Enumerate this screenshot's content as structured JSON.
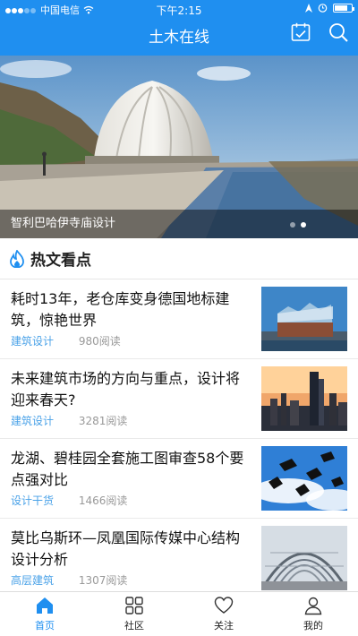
{
  "status_bar": {
    "carrier": "中国电信",
    "time": "下午2:15"
  },
  "nav": {
    "title": "土木在线",
    "icons": [
      "calendar-icon",
      "search-icon"
    ]
  },
  "banner": {
    "caption": "智利巴哈伊寺庙设计",
    "dot_count": 2,
    "active_dot": 2
  },
  "section": {
    "title": "热文看点",
    "icon": "flame-icon"
  },
  "articles": [
    {
      "title": "耗时13年，老仓库变身德国地标建筑，惊艳世界",
      "category": "建筑设计",
      "reads": "980阅读"
    },
    {
      "title": "未来建筑市场的方向与重点，设计将迎来春天?",
      "category": "建筑设计",
      "reads": "3281阅读"
    },
    {
      "title": "龙湖、碧桂园全套施工图审查58个要点强对比",
      "category": "设计干货",
      "reads": "1466阅读"
    },
    {
      "title": "莫比乌斯环—凤凰国际传媒中心结构设计分析",
      "category": "高层建筑",
      "reads": "1307阅读"
    }
  ],
  "tabbar": {
    "tabs": [
      {
        "label": "首页",
        "icon": "home-icon",
        "active": true
      },
      {
        "label": "社区",
        "icon": "grid-icon",
        "active": false
      },
      {
        "label": "关注",
        "icon": "heart-icon",
        "active": false
      },
      {
        "label": "我的",
        "icon": "person-icon",
        "active": false
      }
    ]
  },
  "colors": {
    "brand": "#1f8ff0",
    "category": "#4aa2e8"
  }
}
